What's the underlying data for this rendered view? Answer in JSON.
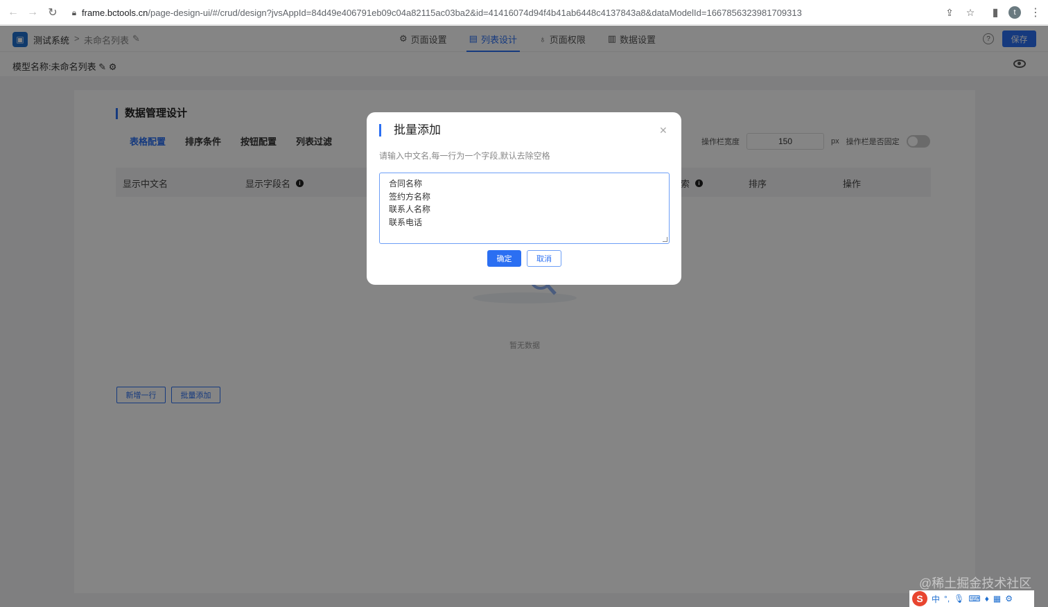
{
  "browser": {
    "url_host": "frame.bctools.cn",
    "url_path": "/page-design-ui/#/crud/design?jvsAppId=84d49e406791eb09c04a82115ac03ba2&id=41416074d94f4b41ab6448c4137843a8&dataModelId=1667856323981709313",
    "avatar_letter": "t"
  },
  "header": {
    "system_name": "测试系统",
    "separator": ">",
    "list_name": "未命名列表",
    "tabs": [
      {
        "label": "页面设置",
        "icon": "gear-icon"
      },
      {
        "label": "列表设计",
        "icon": "list-icon"
      },
      {
        "label": "页面权限",
        "icon": "lock-icon"
      },
      {
        "label": "数据设置",
        "icon": "bar-chart-icon"
      }
    ],
    "active_tab": "列表设计",
    "save_label": "保存"
  },
  "model_bar": {
    "label": "模型名称:",
    "name": "未命名列表"
  },
  "design": {
    "title": "数据管理设计",
    "sub_tabs": [
      "表格配置",
      "排序条件",
      "按钮配置",
      "列表过滤"
    ],
    "active_sub_tab": "表格配置",
    "op_width_label": "操作栏宽度",
    "op_width_value": "150",
    "op_width_unit": "px",
    "op_fixed_label": "操作栏是否固定",
    "columns": [
      "显示中文名",
      "显示字段名",
      "索",
      "排序",
      "操作"
    ],
    "empty_text": "暂无数据",
    "add_row_label": "新增一行",
    "batch_add_label": "批量添加"
  },
  "modal": {
    "title": "批量添加",
    "hint": "请输入中文名,每一行为一个字段,默认去除空格",
    "lines": [
      "合同名称",
      "签约方名称",
      "联系人名称",
      "联系电话"
    ],
    "confirm_label": "确定",
    "cancel_label": "取消"
  },
  "watermark": "@稀土掘金技术社区",
  "ime": {
    "lang": "中"
  },
  "colors": {
    "accent": "#2b6ff2",
    "mask": "rgba(0,0,0,0.48)"
  }
}
